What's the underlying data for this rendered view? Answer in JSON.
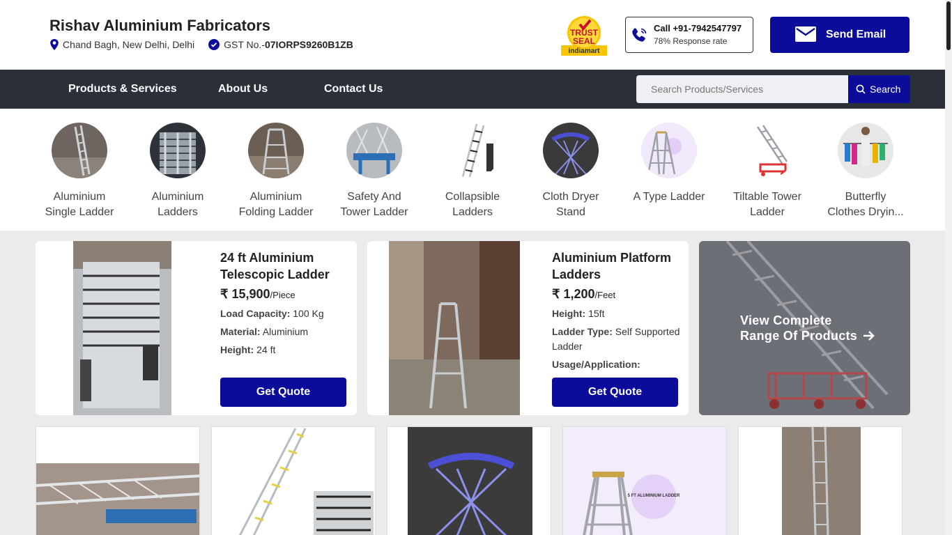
{
  "header": {
    "company_name": "Rishav Aluminium Fabricators",
    "location": "Chand Bagh, New Delhi, Delhi",
    "gst_prefix": "GST No.-",
    "gst_number": "07IORPS9260B1ZB",
    "trust_seal": {
      "line1": "TRUST",
      "line2": "SEAL",
      "line3": "indiamart"
    },
    "call_label": "Call +91-7942547797",
    "response_rate": "78% Response rate",
    "email_label": "Send Email"
  },
  "nav": {
    "items": [
      "Products & Services",
      "About Us",
      "Contact Us"
    ],
    "search_placeholder": "Search Products/Services",
    "search_label": "Search"
  },
  "categories": [
    {
      "name": "Aluminium\nSingle Ladder"
    },
    {
      "name": "Aluminium\nLadders"
    },
    {
      "name": "Aluminium\nFolding Ladder"
    },
    {
      "name": "Safety And\nTower Ladder"
    },
    {
      "name": "Collapsible\nLadders"
    },
    {
      "name": "Cloth Dryer\nStand"
    },
    {
      "name": "A Type Ladder"
    },
    {
      "name": "Tiltable Tower\nLadder"
    },
    {
      "name": "Butterfly\nClothes Dryin..."
    }
  ],
  "featured": [
    {
      "title": "24 ft Aluminium Telescopic Ladder",
      "currency": "₹",
      "price": "15,900",
      "unit": "/Piece",
      "specs": [
        {
          "label": "Load Capacity:",
          "value": "100 Kg"
        },
        {
          "label": "Material:",
          "value": "Aluminium"
        },
        {
          "label": "Height:",
          "value": "24 ft"
        }
      ],
      "quote_label": "Get Quote"
    },
    {
      "title": "Aluminium Platform Ladders",
      "currency": "₹",
      "price": "1,200",
      "unit": "/Feet",
      "specs": [
        {
          "label": "Height:",
          "value": "15ft"
        },
        {
          "label": "Ladder Type:",
          "value": "Self Supported Ladder"
        },
        {
          "label": "Usage/Application:",
          "value": ""
        }
      ],
      "quote_label": "Get Quote"
    }
  ],
  "view_all": {
    "line1": "View Complete",
    "line2": "Range Of Products"
  },
  "product_image_text": "5 FT ALUMINIUM LADDER",
  "colors": {
    "brand_blue": "#0c0c9b",
    "nav_bg": "#2b2f38",
    "page_bg": "#ebebeb"
  },
  "icons": [
    "location-pin-icon",
    "verified-check-icon",
    "phone-icon",
    "mail-icon",
    "search-icon",
    "arrow-right-icon"
  ]
}
